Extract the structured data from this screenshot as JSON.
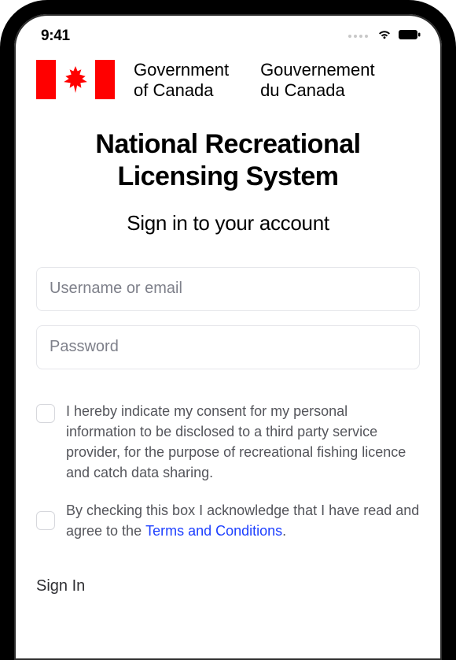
{
  "statusbar": {
    "time": "9:41"
  },
  "gov": {
    "en_line1": "Government",
    "en_line2": "of Canada",
    "fr_line1": "Gouvernement",
    "fr_line2": "du Canada"
  },
  "titles": {
    "page": "National Recreational Licensing System",
    "subtitle": "Sign in to your account"
  },
  "form": {
    "username_placeholder": "Username or email",
    "password_placeholder": "Password",
    "consent_text": "I hereby indicate my consent for my personal information to be disclosed to a third party service provider, for the purpose of recreational fishing licence and catch data sharing.",
    "ack_prefix": "By checking this box I acknowledge that I have read and agree to the ",
    "ack_link": "Terms and Conditions",
    "ack_suffix": ".",
    "signin_label": "Sign In"
  },
  "colors": {
    "flag_red": "#ff0000",
    "link": "#1e40ff"
  }
}
